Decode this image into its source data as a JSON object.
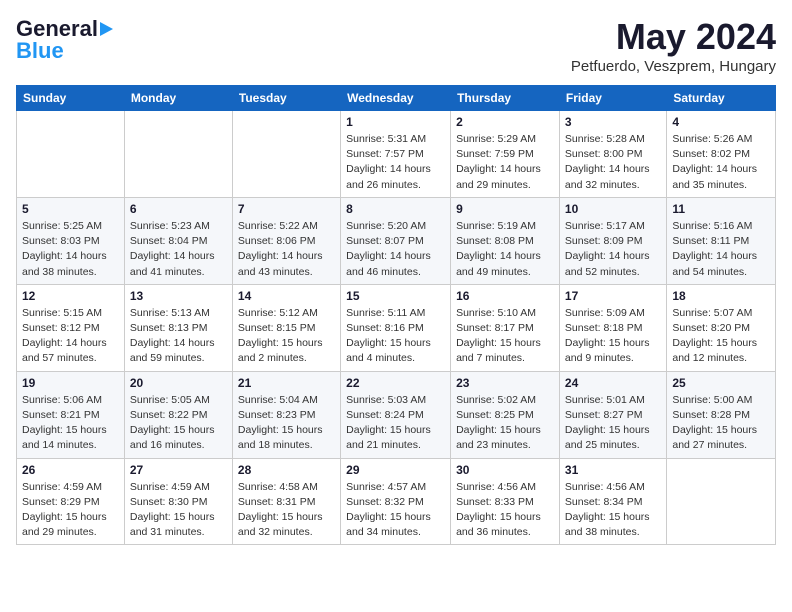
{
  "header": {
    "logo_general": "General",
    "logo_blue": "Blue",
    "month_title": "May 2024",
    "location": "Petfuerdo, Veszprem, Hungary"
  },
  "days_of_week": [
    "Sunday",
    "Monday",
    "Tuesday",
    "Wednesday",
    "Thursday",
    "Friday",
    "Saturday"
  ],
  "weeks": [
    [
      {
        "day": "",
        "info": ""
      },
      {
        "day": "",
        "info": ""
      },
      {
        "day": "",
        "info": ""
      },
      {
        "day": "1",
        "info": "Sunrise: 5:31 AM\nSunset: 7:57 PM\nDaylight: 14 hours\nand 26 minutes."
      },
      {
        "day": "2",
        "info": "Sunrise: 5:29 AM\nSunset: 7:59 PM\nDaylight: 14 hours\nand 29 minutes."
      },
      {
        "day": "3",
        "info": "Sunrise: 5:28 AM\nSunset: 8:00 PM\nDaylight: 14 hours\nand 32 minutes."
      },
      {
        "day": "4",
        "info": "Sunrise: 5:26 AM\nSunset: 8:02 PM\nDaylight: 14 hours\nand 35 minutes."
      }
    ],
    [
      {
        "day": "5",
        "info": "Sunrise: 5:25 AM\nSunset: 8:03 PM\nDaylight: 14 hours\nand 38 minutes."
      },
      {
        "day": "6",
        "info": "Sunrise: 5:23 AM\nSunset: 8:04 PM\nDaylight: 14 hours\nand 41 minutes."
      },
      {
        "day": "7",
        "info": "Sunrise: 5:22 AM\nSunset: 8:06 PM\nDaylight: 14 hours\nand 43 minutes."
      },
      {
        "day": "8",
        "info": "Sunrise: 5:20 AM\nSunset: 8:07 PM\nDaylight: 14 hours\nand 46 minutes."
      },
      {
        "day": "9",
        "info": "Sunrise: 5:19 AM\nSunset: 8:08 PM\nDaylight: 14 hours\nand 49 minutes."
      },
      {
        "day": "10",
        "info": "Sunrise: 5:17 AM\nSunset: 8:09 PM\nDaylight: 14 hours\nand 52 minutes."
      },
      {
        "day": "11",
        "info": "Sunrise: 5:16 AM\nSunset: 8:11 PM\nDaylight: 14 hours\nand 54 minutes."
      }
    ],
    [
      {
        "day": "12",
        "info": "Sunrise: 5:15 AM\nSunset: 8:12 PM\nDaylight: 14 hours\nand 57 minutes."
      },
      {
        "day": "13",
        "info": "Sunrise: 5:13 AM\nSunset: 8:13 PM\nDaylight: 14 hours\nand 59 minutes."
      },
      {
        "day": "14",
        "info": "Sunrise: 5:12 AM\nSunset: 8:15 PM\nDaylight: 15 hours\nand 2 minutes."
      },
      {
        "day": "15",
        "info": "Sunrise: 5:11 AM\nSunset: 8:16 PM\nDaylight: 15 hours\nand 4 minutes."
      },
      {
        "day": "16",
        "info": "Sunrise: 5:10 AM\nSunset: 8:17 PM\nDaylight: 15 hours\nand 7 minutes."
      },
      {
        "day": "17",
        "info": "Sunrise: 5:09 AM\nSunset: 8:18 PM\nDaylight: 15 hours\nand 9 minutes."
      },
      {
        "day": "18",
        "info": "Sunrise: 5:07 AM\nSunset: 8:20 PM\nDaylight: 15 hours\nand 12 minutes."
      }
    ],
    [
      {
        "day": "19",
        "info": "Sunrise: 5:06 AM\nSunset: 8:21 PM\nDaylight: 15 hours\nand 14 minutes."
      },
      {
        "day": "20",
        "info": "Sunrise: 5:05 AM\nSunset: 8:22 PM\nDaylight: 15 hours\nand 16 minutes."
      },
      {
        "day": "21",
        "info": "Sunrise: 5:04 AM\nSunset: 8:23 PM\nDaylight: 15 hours\nand 18 minutes."
      },
      {
        "day": "22",
        "info": "Sunrise: 5:03 AM\nSunset: 8:24 PM\nDaylight: 15 hours\nand 21 minutes."
      },
      {
        "day": "23",
        "info": "Sunrise: 5:02 AM\nSunset: 8:25 PM\nDaylight: 15 hours\nand 23 minutes."
      },
      {
        "day": "24",
        "info": "Sunrise: 5:01 AM\nSunset: 8:27 PM\nDaylight: 15 hours\nand 25 minutes."
      },
      {
        "day": "25",
        "info": "Sunrise: 5:00 AM\nSunset: 8:28 PM\nDaylight: 15 hours\nand 27 minutes."
      }
    ],
    [
      {
        "day": "26",
        "info": "Sunrise: 4:59 AM\nSunset: 8:29 PM\nDaylight: 15 hours\nand 29 minutes."
      },
      {
        "day": "27",
        "info": "Sunrise: 4:59 AM\nSunset: 8:30 PM\nDaylight: 15 hours\nand 31 minutes."
      },
      {
        "day": "28",
        "info": "Sunrise: 4:58 AM\nSunset: 8:31 PM\nDaylight: 15 hours\nand 32 minutes."
      },
      {
        "day": "29",
        "info": "Sunrise: 4:57 AM\nSunset: 8:32 PM\nDaylight: 15 hours\nand 34 minutes."
      },
      {
        "day": "30",
        "info": "Sunrise: 4:56 AM\nSunset: 8:33 PM\nDaylight: 15 hours\nand 36 minutes."
      },
      {
        "day": "31",
        "info": "Sunrise: 4:56 AM\nSunset: 8:34 PM\nDaylight: 15 hours\nand 38 minutes."
      },
      {
        "day": "",
        "info": ""
      }
    ]
  ]
}
